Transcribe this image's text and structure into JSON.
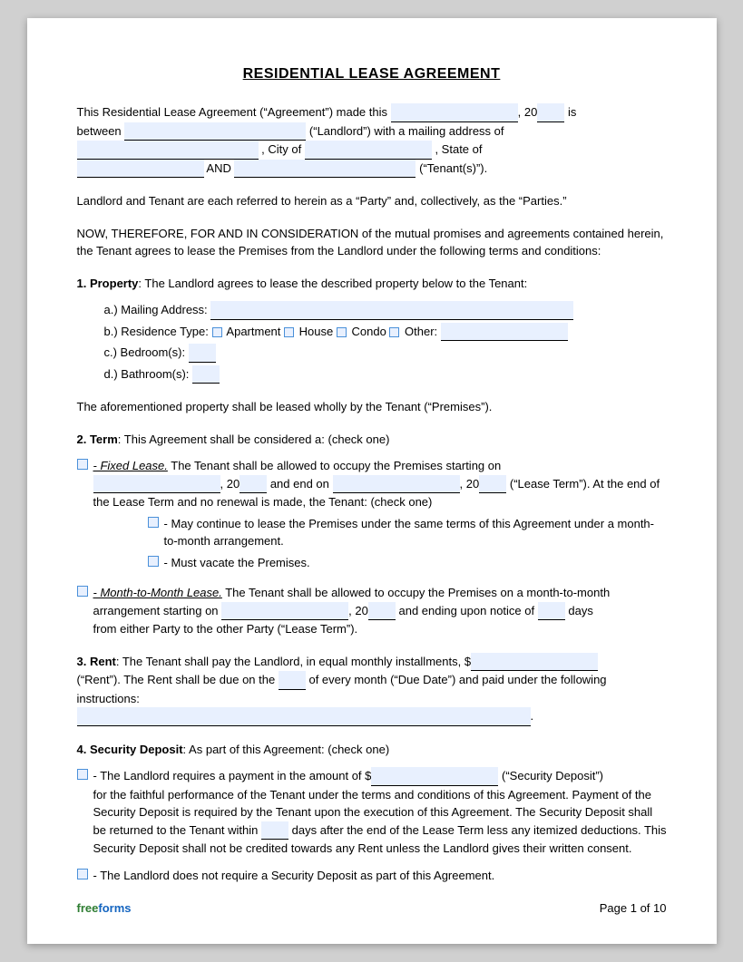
{
  "document": {
    "title": "RESIDENTIAL LEASE AGREEMENT",
    "intro": {
      "line1_start": "This Residential Lease Agreement (“Agreement”) made this",
      "line1_year": "20",
      "line1_end": "is",
      "line2_start": "between",
      "line2_landlord_label": "(“Landlord”) with a mailing address of",
      "line3_city_label": ", City of",
      "line3_state_label": ", State of",
      "line4_and": "AND",
      "line4_tenant_label": "(“Tenant(s)”)."
    },
    "parties_notice": "Landlord and Tenant are each referred to herein as a “Party” and, collectively, as the “Parties.”",
    "now_therefore": "NOW, THEREFORE, FOR AND IN CONSIDERATION of the mutual promises and agreements contained herein, the Tenant agrees to lease the Premises from the Landlord under the following terms and conditions:",
    "section1": {
      "header": "1. Property",
      "text": ": The Landlord agrees to lease the described property below to the Tenant:",
      "a_label": "a.)  Mailing Address:",
      "b_label": "b.)  Residence Type:",
      "b_apartment": "Apartment",
      "b_house": "House",
      "b_condo": "Condo",
      "b_other": "Other:",
      "c_label": "c.)  Bedroom(s):",
      "d_label": "d.)  Bathroom(s):",
      "closing": "The aforementioned property shall be leased wholly by the Tenant (“Premises”)."
    },
    "section2": {
      "header": "2. Term",
      "text": ": This Agreement shall be considered a: (check one)",
      "fixed_label": "- Fixed Lease.",
      "fixed_text": " The Tenant shall be allowed to occupy the Premises starting on",
      "fixed_20a": "20",
      "fixed_and_end": "and end on",
      "fixed_20b": "20",
      "fixed_lease_term": "(“Lease Term”). At the end of the Lease Term and no renewal is made, the Tenant: (check one)",
      "option1": "- May continue to lease the Premises under the same terms of this Agreement under a month-to-month arrangement.",
      "option2": "- Must vacate the Premises.",
      "month_label": "- Month-to-Month Lease.",
      "month_text": " The Tenant shall be allowed to occupy the Premises on a month-to-month arrangement starting on",
      "month_20": "20",
      "month_ending": "and ending upon notice of",
      "month_days": "days",
      "month_close": "from either Party to the other Party (“Lease Term”)."
    },
    "section3": {
      "header": "3. Rent",
      "text": ": The Tenant shall pay the Landlord, in equal monthly installments, $",
      "rent_close": "(“Rent”). The Rent shall be due on the",
      "rent_of_every": "of every month (“Due Date”) and paid under the following instructions:",
      "rent_period": "."
    },
    "section4": {
      "header": "4. Security Deposit",
      "text": ": As part of this Agreement: (check one)",
      "option1_start": "- The Landlord requires a payment in the amount of $",
      "option1_label": "(“Security Deposit”)",
      "option1_body": "for the faithful performance of the Tenant under the terms and conditions of this Agreement. Payment of the Security Deposit is required by the Tenant upon the execution of this Agreement. The Security Deposit shall be returned to the Tenant within",
      "option1_days": "days after the end of the Lease Term less any itemized deductions. This Security Deposit shall not be credited towards any Rent unless the Landlord gives their written consent.",
      "option2": "- The Landlord does not require a Security Deposit as part of this Agreement."
    },
    "footer": {
      "free": "free",
      "forms": "forms",
      "page": "Page 1 of 10"
    }
  }
}
